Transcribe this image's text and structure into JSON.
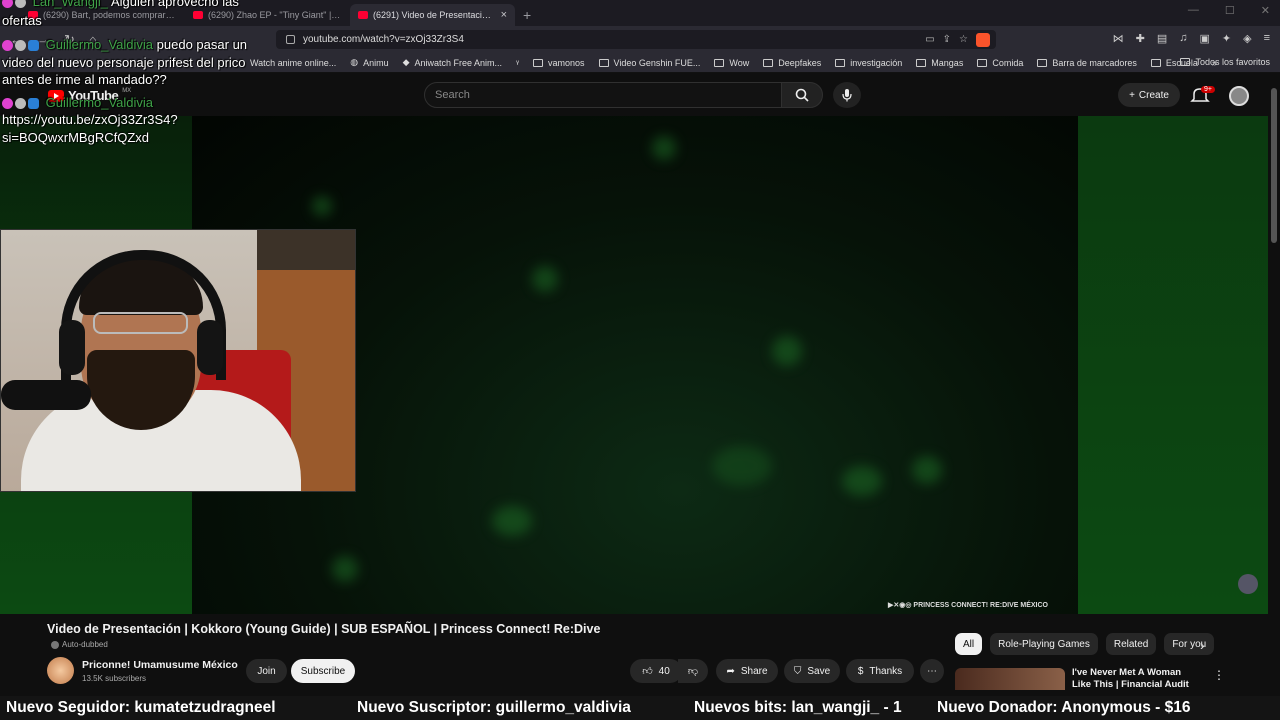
{
  "browser": {
    "tabs": [
      {
        "label": "(6290) Bart, podemos comprar helad..."
      },
      {
        "label": "(6290) Zhao EP - \"Tiny Giant\" | Zenle..."
      },
      {
        "label": "(6291) Video de Presentación..."
      }
    ],
    "url": "youtube.com/watch?v=zxOj33Zr3S4",
    "bookmarks": [
      "Watch anime online...",
      "Animu",
      "Aniwatch Free Anim...",
      "vamonos",
      "Video Genshin FUE...",
      "Wow",
      "Deepfakes",
      "investigación",
      "Mangas",
      "Comida",
      "Barra de marcadores",
      "Escuela"
    ],
    "bookmarks_all": "Todos los favoritos"
  },
  "youtube": {
    "logo": "YouTube",
    "region": "MX",
    "search_placeholder": "Search",
    "create_label": "Create",
    "notif_badge": "9+"
  },
  "chat": [
    {
      "user": "Lan_Wangji_",
      "message": "Alguien aprovechó las",
      "cont": "ofertas"
    },
    {
      "user": "Guillermo_Valdivia",
      "message": "puedo pasar un",
      "cont": "video del nuevo personaje prifest del prico",
      "cont2": "antes de irme al mandado??"
    },
    {
      "user": "Guillermo_Valdivia",
      "message": "",
      "cont": "https://youtu.be/zxOj33Zr3S4?",
      "cont2": "si=BOQwxrMBgRCfQZxd"
    }
  ],
  "video": {
    "watermark": "PRINCESS CONNECT! RE:DIVE MÉXICO",
    "title": "Video de Presentación | Kokkoro (Young Guide) | SUB ESPAÑOL | Princess Connect! Re:Dive",
    "auto_dubbed": "Auto-dubbed",
    "channel": "Priconne! Umamusume México",
    "subscribers": "13.5K subscribers",
    "join_label": "Join",
    "subscribe_label": "Subscribe",
    "likes": "40",
    "share_label": "Share",
    "save_label": "Save",
    "thanks_label": "Thanks"
  },
  "sidebar": {
    "chips": [
      "All",
      "Role-Playing Games",
      "Related",
      "For you"
    ],
    "rec_title": "I've Never Met A Woman Like This | Financial Audit"
  },
  "ticker": {
    "follower": "Nuevo Seguidor: kumatetzudragneel",
    "subscriber": "Nuevo Suscriptor: guillermo_valdivia",
    "bits": "Nuevos bits: lan_wangji_ - 1",
    "donor": "Nuevo Donador: Anonymous - $16"
  }
}
